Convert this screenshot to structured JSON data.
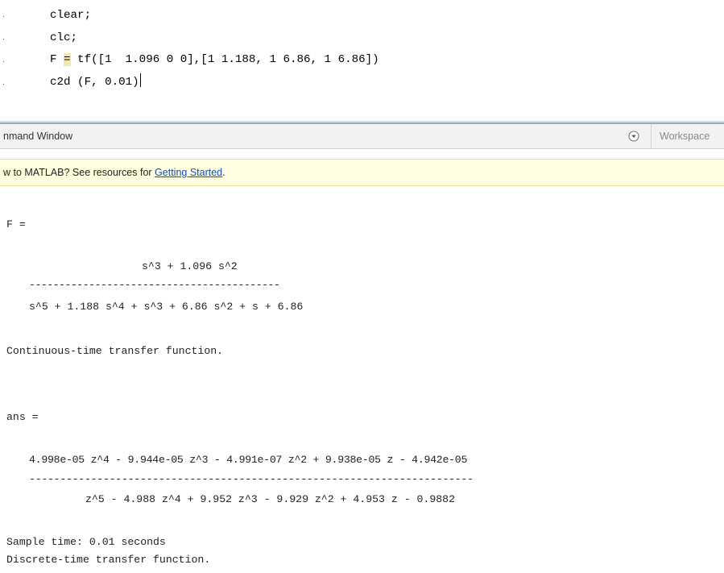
{
  "editor": {
    "lines": [
      {
        "text": "clear;"
      },
      {
        "text": "clc;"
      },
      {
        "pre": "F ",
        "eq": "=",
        "post": " tf([1  1.096 0 0],[1 1.188, 1 6.86, 1 6.86])"
      },
      {
        "text": "c2d (F, 0.01)"
      }
    ]
  },
  "command_window": {
    "title": "nmand Window",
    "workspace_tab": "Workspace"
  },
  "info_bar": {
    "prefix": "w to MATLAB? See resources for ",
    "link": "Getting Started",
    "suffix": "."
  },
  "output": {
    "f_label": "F =",
    "f_numerator": "s^3 + 1.096 s^2",
    "f_dashes": "------------------------------------------",
    "f_denominator": "s^5 + 1.188 s^4 + s^3 + 6.86 s^2 + s + 6.86",
    "f_type": "Continuous-time transfer function.",
    "ans_label": "ans =",
    "ans_numerator": "4.998e-05 z^4 - 9.944e-05 z^3 - 4.991e-07 z^2 + 9.938e-05 z - 4.942e-05",
    "ans_dashes": "------------------------------------------------------------------------",
    "ans_denominator": "z^5 - 4.988 z^4 + 9.952 z^3 - 9.929 z^2 + 4.953 z - 0.9882",
    "sample_time": "Sample time: 0.01 seconds",
    "ans_type": "Discrete-time transfer function."
  }
}
